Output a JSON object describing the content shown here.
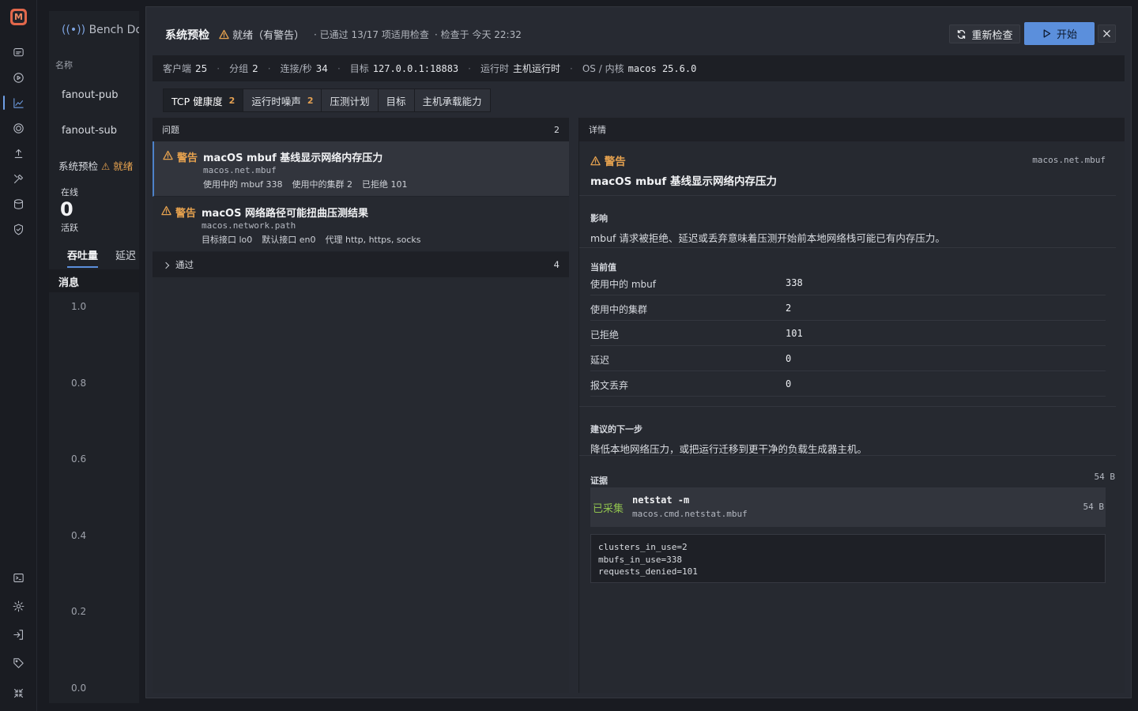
{
  "rail": {
    "logo_letter": "M"
  },
  "background": {
    "app_title": "Bench Doc",
    "col_name": "名称",
    "rows": [
      "fanout-pub",
      "fanout-sub"
    ],
    "preflight": "系统预检",
    "preflight_status": "就绪",
    "online_label": "在线",
    "online_value": "0",
    "active_label": "活跃",
    "tab_throughput": "吞吐量",
    "tab_latency": "延迟",
    "messages_label": "消息",
    "y_ticks": [
      "1.0",
      "0.8",
      "0.6",
      "0.4",
      "0.2",
      "0.0"
    ]
  },
  "modal": {
    "title": "系统预检",
    "status": "就绪（有警告）",
    "passed": "已通过 13/17 项适用检查",
    "checked": "检查于 今天 22:32",
    "recheck_label": "重新检查",
    "start_label": "开始"
  },
  "meta": {
    "clients_k": "客户端",
    "clients_v": "25",
    "groups_k": "分组",
    "groups_v": "2",
    "cps_k": "连接/秒",
    "cps_v": "34",
    "target_k": "目标",
    "target_v": "127.0.0.1:18883",
    "runtime_k": "运行时",
    "runtime_v": "主机运行时",
    "os_k": "OS / 内核",
    "os_v": "macos 25.6.0"
  },
  "tabs": [
    {
      "label": "TCP 健康度",
      "count": "2"
    },
    {
      "label": "运行时噪声",
      "count": "2"
    },
    {
      "label": "压测计划",
      "count": ""
    },
    {
      "label": "目标",
      "count": ""
    },
    {
      "label": "主机承载能力",
      "count": ""
    }
  ],
  "issues": {
    "header": "问题",
    "count": "2",
    "items": [
      {
        "level": "警告",
        "title": "macOS mbuf 基线显示网络内存压力",
        "id": "macos.net.mbuf",
        "facts": [
          "使用中的 mbuf 338",
          "使用中的集群 2",
          "已拒绝 101"
        ]
      },
      {
        "level": "警告",
        "title": "macOS 网络路径可能扭曲压测结果",
        "id": "macos.network.path",
        "facts": [
          "目标接口 lo0",
          "默认接口 en0",
          "代理 http, https, socks"
        ]
      }
    ],
    "passed_label": "通过",
    "passed_count": "4"
  },
  "detail": {
    "header": "详情",
    "level": "警告",
    "title": "macOS mbuf 基线显示网络内存压力",
    "id": "macos.net.mbuf",
    "impact_label": "影响",
    "impact": "mbuf 请求被拒绝、延迟或丢弃意味着压测开始前本地网络栈可能已有内存压力。",
    "current_label": "当前值",
    "values": [
      {
        "k": "使用中的 mbuf",
        "v": "338"
      },
      {
        "k": "使用中的集群",
        "v": "2"
      },
      {
        "k": "已拒绝",
        "v": "101"
      },
      {
        "k": "延迟",
        "v": "0"
      },
      {
        "k": "报文丢弃",
        "v": "0"
      }
    ],
    "next_label": "建议的下一步",
    "next": "降低本地网络压力，或把运行迁移到更干净的负载生成器主机。",
    "evidence_label": "证据",
    "evidence_size": "54 B",
    "evidence_status": "已采集",
    "evidence_cmd": "netstat -m",
    "evidence_id": "macos.cmd.netstat.mbuf",
    "evidence_item_size": "54 B",
    "output_lines": [
      "clusters_in_use=2",
      "mbufs_in_use=338",
      "requests_denied=101"
    ]
  },
  "colors": {
    "accent": "#5b8fdc",
    "warning": "#e6a24f",
    "ok": "#8fc14e"
  }
}
